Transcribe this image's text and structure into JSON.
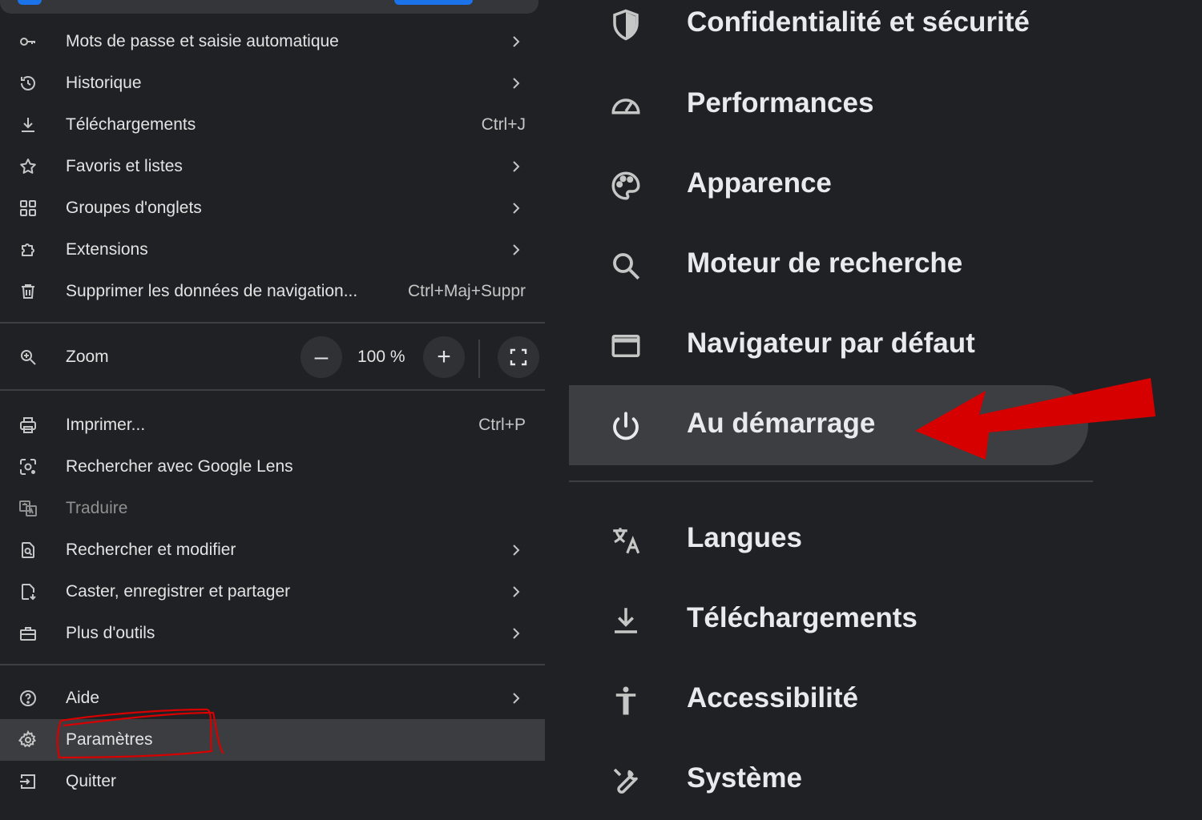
{
  "menu": {
    "items_top": [
      {
        "label": "Mots de passe et saisie automatique",
        "icon": "key-icon",
        "shortcut": "",
        "has_submenu": true
      },
      {
        "label": "Historique",
        "icon": "history-icon",
        "shortcut": "",
        "has_submenu": true
      },
      {
        "label": "Téléchargements",
        "icon": "download-icon",
        "shortcut": "Ctrl+J",
        "has_submenu": false
      },
      {
        "label": "Favoris et listes",
        "icon": "star-icon",
        "shortcut": "",
        "has_submenu": true
      },
      {
        "label": "Groupes d'onglets",
        "icon": "tab-groups-icon",
        "shortcut": "",
        "has_submenu": true
      },
      {
        "label": "Extensions",
        "icon": "puzzle-icon",
        "shortcut": "",
        "has_submenu": true
      },
      {
        "label": "Supprimer les données de navigation...",
        "icon": "trash-icon",
        "shortcut": "Ctrl+Maj+Suppr",
        "has_submenu": false
      }
    ],
    "zoom": {
      "label": "Zoom",
      "value": "100 %",
      "minus": "–",
      "plus": "+"
    },
    "items_mid": [
      {
        "label": "Imprimer...",
        "icon": "printer-icon",
        "shortcut": "Ctrl+P",
        "has_submenu": false
      },
      {
        "label": "Rechercher avec Google Lens",
        "icon": "google-lens-icon",
        "shortcut": "",
        "has_submenu": false
      },
      {
        "label": "Traduire",
        "icon": "translate-icon",
        "shortcut": "",
        "has_submenu": false,
        "disabled": true
      },
      {
        "label": "Rechercher et modifier",
        "icon": "find-in-page-icon",
        "shortcut": "",
        "has_submenu": true
      },
      {
        "label": "Caster, enregistrer et partager",
        "icon": "cast-save-icon",
        "shortcut": "",
        "has_submenu": true
      },
      {
        "label": "Plus d'outils",
        "icon": "toolbox-icon",
        "shortcut": "",
        "has_submenu": true
      }
    ],
    "items_bottom": [
      {
        "label": "Aide",
        "icon": "help-icon",
        "has_submenu": true
      },
      {
        "label": "Paramètres",
        "icon": "gear-icon",
        "has_submenu": false,
        "highlighted": true
      },
      {
        "label": "Quitter",
        "icon": "exit-icon",
        "has_submenu": false
      }
    ]
  },
  "settings_nav": {
    "items": [
      {
        "label": "Confidentialité et sécurité",
        "icon": "shield-icon"
      },
      {
        "label": "Performances",
        "icon": "speedometer-icon"
      },
      {
        "label": "Apparence",
        "icon": "palette-icon"
      },
      {
        "label": "Moteur de recherche",
        "icon": "search-icon"
      },
      {
        "label": "Navigateur par défaut",
        "icon": "browser-window-icon"
      },
      {
        "label": "Au démarrage",
        "icon": "power-icon",
        "selected": true
      },
      {
        "label": "Langues",
        "icon": "translate-icon"
      },
      {
        "label": "Téléchargements",
        "icon": "download-icon"
      },
      {
        "label": "Accessibilité",
        "icon": "accessibility-icon"
      },
      {
        "label": "Système",
        "icon": "wrench-icon"
      }
    ]
  },
  "colors": {
    "background": "#202124",
    "selected_row": "#3c3e42",
    "annotation_red": "#d60000",
    "accent_blue": "#1a73e8"
  }
}
